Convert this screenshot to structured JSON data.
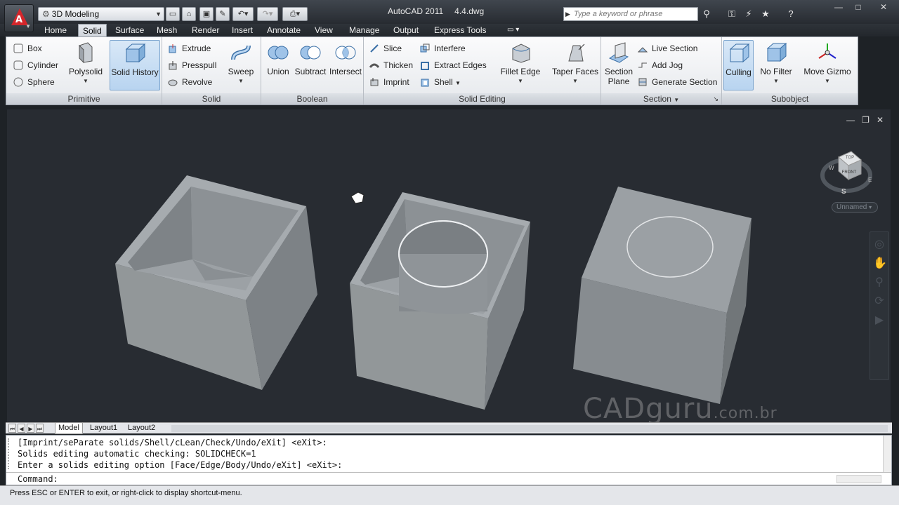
{
  "titlebar": {
    "workspace": "3D Modeling",
    "app_name": "AutoCAD 2011",
    "file_name": "4.4.dwg",
    "search_placeholder": "Type a keyword or phrase"
  },
  "ribbon_tabs": [
    "Home",
    "Solid",
    "Surface",
    "Mesh",
    "Render",
    "Insert",
    "Annotate",
    "View",
    "Manage",
    "Output",
    "Express Tools"
  ],
  "active_tab": "Solid",
  "panels": {
    "primitive": {
      "title": "Primitive",
      "box": "Box",
      "cylinder": "Cylinder",
      "sphere": "Sphere",
      "polysolid": "Polysolid"
    },
    "solid": {
      "title": "Solid",
      "solid_history": "Solid History",
      "extrude": "Extrude",
      "presspull": "Presspull",
      "revolve": "Revolve",
      "sweep": "Sweep"
    },
    "boolean": {
      "title": "Boolean",
      "union": "Union",
      "subtract": "Subtract",
      "intersect": "Intersect"
    },
    "solid_editing": {
      "title": "Solid Editing",
      "slice": "Slice",
      "thicken": "Thicken",
      "imprint": "Imprint",
      "interfere": "Interfere",
      "extract_edges": "Extract Edges",
      "shell": "Shell",
      "fillet_edge": "Fillet Edge",
      "taper_faces": "Taper Faces"
    },
    "section": {
      "title": "Section",
      "section_plane_1": "Section",
      "section_plane_2": "Plane",
      "live_section": "Live Section",
      "add_jog": "Add Jog",
      "generate_section": "Generate Section"
    },
    "subobject": {
      "title": "Subobject",
      "culling": "Culling",
      "no_filter": "No Filter",
      "move_gizmo": "Move Gizmo"
    }
  },
  "viewcube": {
    "top": "TOP",
    "front": "FRONT",
    "west": "W",
    "east": "E",
    "south": "S",
    "ucs": "Unnamed"
  },
  "watermark": {
    "main": "CADguru",
    "suffix": ".com.br"
  },
  "layout_tabs": [
    "Model",
    "Layout1",
    "Layout2"
  ],
  "command": {
    "lines": [
      "[Imprint/seParate solids/Shell/cLean/Check/Undo/eXit] <eXit>:",
      "Solids editing automatic checking:  SOLIDCHECK=1",
      "Enter a solids editing option [Face/Edge/Body/Undo/eXit] <eXit>:"
    ],
    "prompt": "Command:"
  },
  "status": "Press ESC or ENTER to exit, or right-click to display shortcut-menu.",
  "colors": {
    "accent": "#d4262b",
    "solid_face_light": "#a9aeb3",
    "solid_face_mid": "#8d9297",
    "solid_face_dark": "#767b80",
    "viewport_bg": "#282c32"
  }
}
